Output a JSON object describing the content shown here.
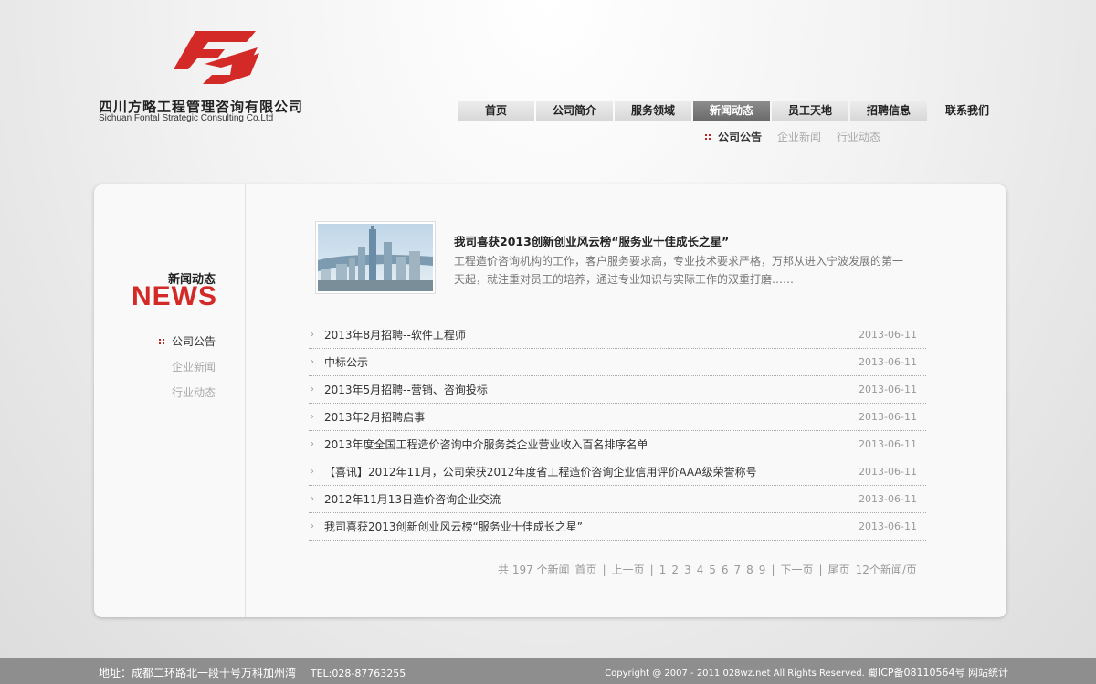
{
  "company": {
    "name_cn": "四川方略工程管理咨询有限公司",
    "name_en": "Sichuan Fontal Strategic  Consulting Co.Ltd"
  },
  "nav": {
    "items": [
      "首页",
      "公司简介",
      "服务领域",
      "新闻动态",
      "员工天地",
      "招聘信息",
      "联系我们"
    ],
    "active": "新闻动态"
  },
  "subnav": {
    "items": [
      "公司公告",
      "企业新闻",
      "行业动态"
    ],
    "active": "公司公告"
  },
  "sidebar": {
    "title_cn": "新闻动态",
    "title_en": "NEWS",
    "links": [
      "公司公告",
      "企业新闻",
      "行业动态"
    ]
  },
  "featured": {
    "title": "我司喜获2013创新创业风云榜“服务业十佳成长之星”",
    "desc": "工程造价咨询机构的工作，客户服务要求高，专业技术要求严格，万邦从进入宁波发展的第一天起，就注重对员工的培养，通过专业知识与实际工作的双重打磨……"
  },
  "news": [
    {
      "title": "2013年8月招聘--软件工程师",
      "date": "2013-06-11"
    },
    {
      "title": "中标公示",
      "date": "2013-06-11"
    },
    {
      "title": "2013年5月招聘--营销、咨询投标",
      "date": "2013-06-11"
    },
    {
      "title": "2013年2月招聘启事",
      "date": "2013-06-11"
    },
    {
      "title": "2013年度全国工程造价咨询中介服务类企业营业收入百名排序名单",
      "date": "2013-06-11"
    },
    {
      "title": "【喜讯】2012年11月，公司荣获2012年度省工程造价咨询企业信用评价AAA级荣誉称号",
      "date": "2013-06-11"
    },
    {
      "title": "2012年11月13日造价咨询企业交流",
      "date": "2013-06-11"
    },
    {
      "title": "我司喜获2013创新创业风云榜“服务业十佳成长之星”",
      "date": "2013-06-11"
    }
  ],
  "pager": {
    "total": "共 197 个新闻",
    "first": "首页",
    "prev": "上一页",
    "pages": [
      "1",
      "2",
      "3",
      "4",
      "5",
      "6",
      "7",
      "8",
      "9"
    ],
    "next": "下一页",
    "last": "尾页",
    "per_page": "12个新闻/页"
  },
  "footer": {
    "address": "地址：成都二环路北一段十号万科加州湾",
    "tel": "TEL:028-87763255",
    "copyright": "Copyright @ 2007 - 2011 028wz.net All Rights Reserved.",
    "icp": "蜀ICP备08110564号 网站统计"
  },
  "colors": {
    "brand_red": "#d42a27",
    "nav_active": "#7a7a7a",
    "footer_bg": "#8e8e8e"
  }
}
